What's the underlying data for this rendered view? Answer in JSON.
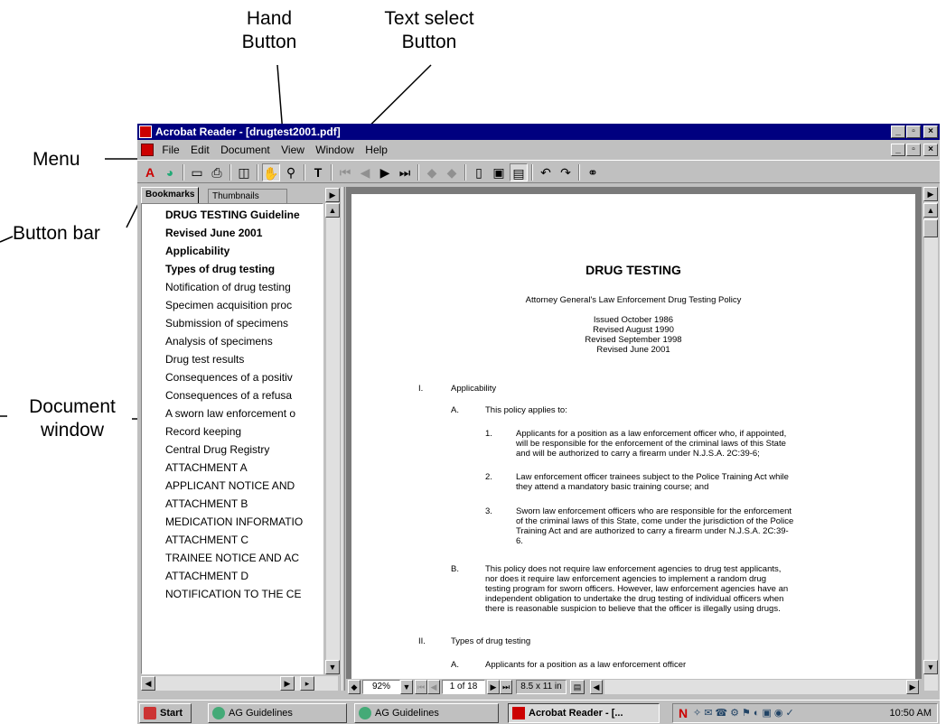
{
  "annotations": {
    "hand": "Hand\nButton",
    "text_select": "Text select\nButton",
    "menu": "Menu",
    "button_bar": "Button bar",
    "document_window": "Document\nwindow"
  },
  "window": {
    "title": "Acrobat Reader - [drugtest2001.pdf]",
    "min": "_",
    "max": "▫",
    "close": "×"
  },
  "menu": [
    "File",
    "Edit",
    "Document",
    "View",
    "Window",
    "Help"
  ],
  "nav": {
    "tab_bookmarks": "Bookmarks",
    "tab_thumbnails": "Thumbnails",
    "bookmarks": [
      {
        "label": "DRUG TESTING Guideline",
        "bold": true
      },
      {
        "label": "Revised June 2001",
        "bold": true
      },
      {
        "label": "Applicability",
        "bold": true
      },
      {
        "label": "Types of drug testing",
        "bold": true
      },
      {
        "label": "Notification of drug testing",
        "bold": false
      },
      {
        "label": "Specimen acquisition proc",
        "bold": false
      },
      {
        "label": "Submission of specimens",
        "bold": false
      },
      {
        "label": "Analysis of specimens",
        "bold": false
      },
      {
        "label": "Drug test results",
        "bold": false
      },
      {
        "label": "Consequences of a positiv",
        "bold": false
      },
      {
        "label": "Consequences of a refusa",
        "bold": false
      },
      {
        "label": "A sworn law enforcement o",
        "bold": false
      },
      {
        "label": "Record keeping",
        "bold": false
      },
      {
        "label": "Central Drug Registry",
        "bold": false
      },
      {
        "label": "ATTACHMENT A",
        "bold": false
      },
      {
        "label": "APPLICANT NOTICE AND",
        "bold": false
      },
      {
        "label": "ATTACHMENT B",
        "bold": false
      },
      {
        "label": "MEDICATION INFORMATIO",
        "bold": false
      },
      {
        "label": "ATTACHMENT C",
        "bold": false
      },
      {
        "label": "TRAINEE NOTICE AND AC",
        "bold": false
      },
      {
        "label": "ATTACHMENT D",
        "bold": false
      },
      {
        "label": "NOTIFICATION TO THE CE",
        "bold": false
      }
    ]
  },
  "doc": {
    "title": "DRUG TESTING",
    "subtitle": "Attorney General's Law Enforcement Drug Testing Policy",
    "dates": [
      "Issued October 1986",
      "Revised August 1990",
      "Revised September 1998",
      "Revised June 2001"
    ],
    "sec1_num": "I.",
    "sec1_title": "Applicability",
    "a_num": "A.",
    "a_text": "This policy applies to:",
    "items": [
      {
        "num": "1.",
        "lines": [
          "Applicants for a position as a law enforcement officer who, if appointed,",
          "will be responsible for the enforcement of the criminal laws of this State",
          "and will be authorized to carry a firearm under N.J.S.A. 2C:39-6;"
        ]
      },
      {
        "num": "2.",
        "lines": [
          "Law enforcement officer trainees subject to the Police Training Act while",
          "they attend a mandatory basic training course; and"
        ]
      },
      {
        "num": "3.",
        "lines": [
          "Sworn law enforcement officers who are responsible for the enforcement",
          "of the criminal laws of this State, come under the jurisdiction of the Police",
          "Training Act and are authorized to carry a firearm under N.J.S.A. 2C:39-",
          "6."
        ]
      }
    ],
    "b_num": "B.",
    "b_lines": [
      "This policy does not require law enforcement agencies to drug test applicants,",
      "nor does it require law enforcement agencies to implement a random drug",
      "testing program for sworn officers.  However, law enforcement agencies have an",
      "independent obligation to undertake the drug testing of individual officers when",
      "there is reasonable suspicion to believe that the officer is illegally using drugs."
    ],
    "sec2_num": "II.",
    "sec2_title": "Types of drug testing",
    "a2_num": "A.",
    "a2_text": "Applicants for a position as a law enforcement officer"
  },
  "status": {
    "zoom": "92%",
    "page": "1 of 18",
    "size": "8.5 x 11 in"
  },
  "taskbar": {
    "start": "Start",
    "items": [
      "AG Guidelines",
      "AG Guidelines",
      "Acrobat Reader - [..."
    ],
    "clock": "10:50 AM"
  }
}
